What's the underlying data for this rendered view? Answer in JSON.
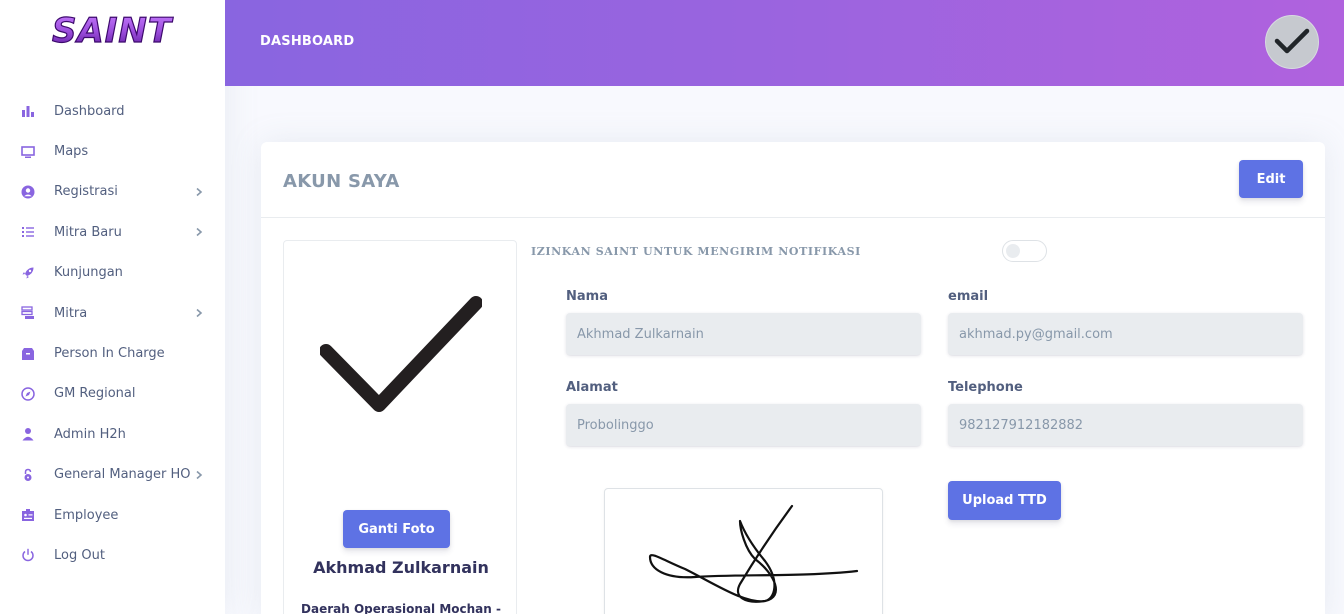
{
  "brand": {
    "logo_text": "SAINT",
    "accent": "#5e72e4",
    "logo_color": "#7b2cbf"
  },
  "sidebar": {
    "items": [
      {
        "label": "Dashboard",
        "icon": "bar-chart-icon",
        "chevron": false
      },
      {
        "label": "Maps",
        "icon": "monitor-icon",
        "chevron": false
      },
      {
        "label": "Registrasi",
        "icon": "user-circle-icon",
        "chevron": true
      },
      {
        "label": "Mitra Baru",
        "icon": "list-icon",
        "chevron": true
      },
      {
        "label": "Kunjungan",
        "icon": "rocket-icon",
        "chevron": false
      },
      {
        "label": "Mitra",
        "icon": "server-icon",
        "chevron": true
      },
      {
        "label": "Person In Charge",
        "icon": "box-icon",
        "chevron": false
      },
      {
        "label": "GM Regional",
        "icon": "compass-icon",
        "chevron": false
      },
      {
        "label": "Admin H2h",
        "icon": "user-icon",
        "chevron": false
      },
      {
        "label": "General Manager HO",
        "icon": "lock-icon",
        "chevron": true
      },
      {
        "label": "Employee",
        "icon": "id-card-icon",
        "chevron": false
      },
      {
        "label": "Log Out",
        "icon": "power-icon",
        "chevron": false
      }
    ]
  },
  "header": {
    "title": "DASHBOARD",
    "avatar_icon": "checkmark-icon"
  },
  "card": {
    "title": "AKUN SAYA",
    "edit_label": "Edit",
    "profile": {
      "change_photo_label": "Ganti Foto",
      "name": "Akhmad Zulkarnain",
      "region": "Daerah Operasional Mochan -"
    },
    "notification": {
      "label": "IZINKAN SAINT UNTUK MENGIRIM NOTIFIKASI",
      "enabled": false
    },
    "form": {
      "nama_label": "Nama",
      "nama_value": "Akhmad Zulkarnain",
      "email_label": "email",
      "email_value": "akhmad.py@gmail.com",
      "alamat_label": "Alamat",
      "alamat_value": "Probolinggo",
      "telephone_label": "Telephone",
      "telephone_value": "982127912182882"
    },
    "upload_ttd_label": "Upload TTD"
  }
}
